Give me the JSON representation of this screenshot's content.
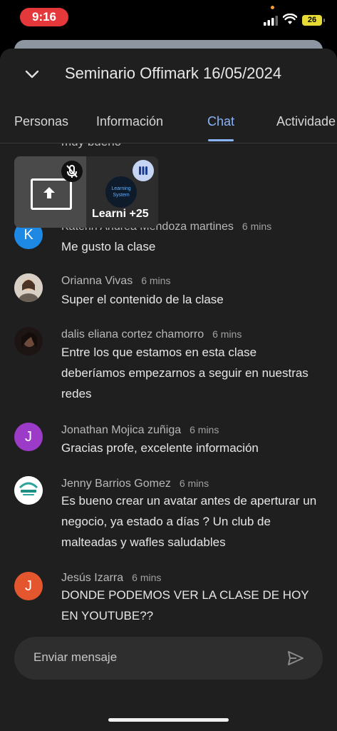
{
  "status_bar": {
    "time": "9:16",
    "battery": "26"
  },
  "header": {
    "title": "Seminario Offimark 16/05/2024"
  },
  "tabs": [
    {
      "label": "Personas"
    },
    {
      "label": "Información"
    },
    {
      "label": "Chat"
    },
    {
      "label": "Actividade"
    }
  ],
  "chat": {
    "partial_text": "muy bueno",
    "tile": {
      "label": "Learni",
      "count": "+25",
      "logo_text": "Learning System"
    },
    "messages": [
      {
        "author": "Katerin Andrea Mendoza martines",
        "time": "6 mins",
        "text": "Me gusto la clase",
        "avatar_letter": "K",
        "avatar_color": "#1e88e5"
      },
      {
        "author": "Orianna Vivas",
        "time": "6 mins",
        "text": "Super el contenido de la clase",
        "avatar_letter": "",
        "avatar_color": "#c8b8a0"
      },
      {
        "author": "dalis eliana cortez chamorro",
        "time": "6 mins",
        "text": "Entre los que estamos en esta clase deberíamos empezarnos a seguir en nuestras redes",
        "avatar_letter": "",
        "avatar_color": "#3a2a26"
      },
      {
        "author": "Jonathan Mojica zuñiga",
        "time": "6 mins",
        "text": "Gracias profe, excelente información",
        "avatar_letter": "J",
        "avatar_color": "#9c3bc7"
      },
      {
        "author": "Jenny Barrios Gomez",
        "time": "6 mins",
        "text": "Es bueno crear un avatar antes de aperturar un negocio, ya estado a días ? Un club de malteadas y wafles saludables",
        "avatar_letter": "",
        "avatar_color": "#ffffff"
      },
      {
        "author": "Jesús Izarra",
        "time": "6 mins",
        "text": "DONDE PODEMOS VER LA CLASE DE HOY EN YOUTUBE??",
        "avatar_letter": "J",
        "avatar_color": "#e4572e"
      }
    ]
  },
  "input": {
    "placeholder": "Enviar mensaje"
  }
}
